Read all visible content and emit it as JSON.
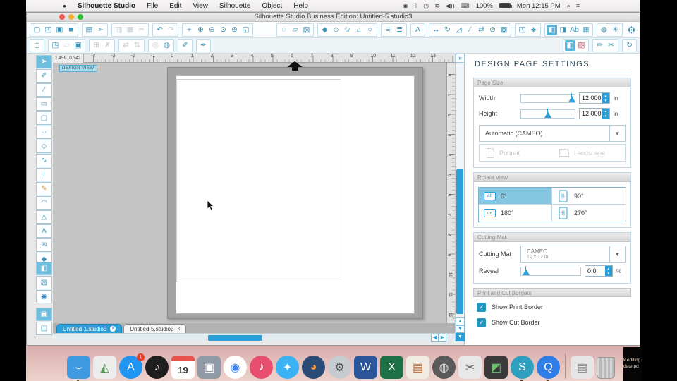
{
  "menu_bar": {
    "apple_glyph": "●",
    "items": [
      "Silhouette Studio",
      "File",
      "Edit",
      "View",
      "Silhouette",
      "Object",
      "Help"
    ],
    "status": {
      "icons_left": [
        {
          "name": "screen-record-icon",
          "glyph": "◉"
        },
        {
          "name": "bluetooth-icon",
          "glyph": "ᛒ"
        },
        {
          "name": "time-machine-icon",
          "glyph": "◷"
        },
        {
          "name": "wifi-icon",
          "glyph": "≋"
        },
        {
          "name": "volume-icon",
          "glyph": "◀))"
        },
        {
          "name": "input-source-icon",
          "glyph": "⌨"
        }
      ],
      "battery_percent": "100%",
      "clock": "Mon 12:15 PM",
      "icons_right": [
        {
          "name": "spotlight-icon",
          "glyph": "⌕"
        },
        {
          "name": "notification-center-icon",
          "glyph": "≡"
        }
      ]
    }
  },
  "window": {
    "title": "Silhouette Studio Business Edition: Untitled-5.studio3"
  },
  "toolbar_main": {
    "groups_left": [
      [
        {
          "name": "new-file-icon",
          "glyph": "▢"
        },
        {
          "name": "open-file-icon",
          "glyph": "◰"
        },
        {
          "name": "save-icon",
          "glyph": "▣"
        },
        {
          "name": "save-as-icon",
          "glyph": "■"
        }
      ],
      [
        {
          "name": "print-icon",
          "glyph": "▤"
        },
        {
          "name": "send-to-machine-icon",
          "glyph": "➢"
        }
      ],
      [
        {
          "name": "copy-icon",
          "glyph": "▥",
          "state": "disabled"
        },
        {
          "name": "paste-icon",
          "glyph": "▦",
          "state": "disabled"
        },
        {
          "name": "cut-icon",
          "glyph": "✂",
          "state": "disabled"
        }
      ],
      [
        {
          "name": "undo-icon",
          "glyph": "↶"
        },
        {
          "name": "redo-icon",
          "glyph": "↷",
          "state": "disabled"
        }
      ],
      [
        {
          "name": "pan-icon",
          "glyph": "⌖"
        },
        {
          "name": "zoom-in-icon",
          "glyph": "⊕"
        },
        {
          "name": "zoom-out-icon",
          "glyph": "⊖"
        },
        {
          "name": "zoom-selection-icon",
          "glyph": "⊙"
        },
        {
          "name": "drag-zoom-icon",
          "glyph": "⊛"
        },
        {
          "name": "fit-to-page-icon",
          "glyph": "◱"
        }
      ]
    ],
    "groups_right": [
      [
        {
          "name": "lasso-icon",
          "glyph": "◌"
        },
        {
          "name": "draw-selection-icon",
          "glyph": "▱"
        },
        {
          "name": "select-by-color-icon",
          "glyph": "▧"
        }
      ],
      [
        {
          "name": "fill-color-icon",
          "glyph": "◆"
        },
        {
          "name": "line-color-icon",
          "glyph": "◇"
        },
        {
          "name": "fill-pattern-icon",
          "glyph": "✩"
        },
        {
          "name": "fill-gradient-icon",
          "glyph": "⌂"
        },
        {
          "name": "shape-style-icon",
          "glyph": "○"
        }
      ],
      [
        {
          "name": "line-style-icon",
          "glyph": "≡"
        },
        {
          "name": "line-thickness-icon",
          "glyph": "≣"
        }
      ],
      [
        {
          "name": "text-style-icon",
          "glyph": "A"
        }
      ],
      [
        {
          "name": "move-icon",
          "glyph": "↔"
        },
        {
          "name": "rotate-icon",
          "glyph": "↻"
        },
        {
          "name": "scale-icon",
          "glyph": "◿"
        },
        {
          "name": "shear-icon",
          "glyph": "∕"
        },
        {
          "name": "mirror-icon",
          "glyph": "⇄"
        },
        {
          "name": "erase-icon",
          "glyph": "⊘"
        },
        {
          "name": "image-effects-icon",
          "glyph": "▩"
        }
      ],
      [
        {
          "name": "offset-icon",
          "glyph": "◳"
        },
        {
          "name": "symbol-icon",
          "glyph": "◈"
        }
      ],
      [
        {
          "name": "page-settings-icon",
          "glyph": "◧",
          "state": "active"
        },
        {
          "name": "registration-marks-icon",
          "glyph": "◨"
        },
        {
          "name": "text-options-icon",
          "glyph": "Ab"
        },
        {
          "name": "grid-options-icon",
          "glyph": "▦"
        }
      ],
      [
        {
          "name": "object-color-icon",
          "glyph": "◍"
        },
        {
          "name": "effects-icon",
          "glyph": "✳"
        }
      ]
    ],
    "gear": {
      "name": "preferences-gear-icon",
      "glyph": "⚙"
    }
  },
  "toolbar_quick": {
    "groups_left": [
      [
        {
          "name": "selection-tools-icon",
          "glyph": "◻"
        }
      ],
      [
        {
          "name": "zoom-to-selection-icon",
          "glyph": "◳"
        },
        {
          "name": "copy-merge-icon",
          "glyph": "▱",
          "state": "disabled"
        },
        {
          "name": "duplicate-icon",
          "glyph": "▣"
        }
      ],
      [
        {
          "name": "group-icon",
          "glyph": "⊞",
          "state": "disabled"
        },
        {
          "name": "delete-icon",
          "glyph": "✗",
          "state": "disabled"
        }
      ],
      [
        {
          "name": "replicate-icon",
          "glyph": "⇄",
          "state": "disabled"
        },
        {
          "name": "nest-icon",
          "glyph": "⇅",
          "state": "disabled"
        }
      ],
      [
        {
          "name": "weld-icon",
          "glyph": "◎",
          "state": "disabled"
        },
        {
          "name": "trace-icon",
          "glyph": "◍"
        }
      ],
      [
        {
          "name": "eraser-icon",
          "glyph": "✐"
        }
      ],
      [
        {
          "name": "knife-icon",
          "glyph": "✒"
        }
      ]
    ],
    "groups_right": [
      [
        {
          "name": "design-page-settings-icon",
          "glyph": "◧",
          "state": "active"
        },
        {
          "name": "pixscan-icon",
          "glyph": "▨",
          "fg": "#b05a6a"
        }
      ],
      [
        {
          "name": "sketch-pens-icon",
          "glyph": "✏"
        },
        {
          "name": "send-to-cutter-icon",
          "glyph": "✂"
        }
      ],
      [
        {
          "name": "sync-icon",
          "glyph": "↻"
        }
      ]
    ]
  },
  "tool_palette": {
    "groups": [
      [
        {
          "name": "select-tool-icon",
          "glyph": "➤",
          "state": "active"
        },
        {
          "name": "edit-points-tool-icon",
          "glyph": "✐"
        },
        {
          "name": "line-tool-icon",
          "glyph": "∕"
        },
        {
          "name": "rectangle-tool-icon",
          "glyph": "▭"
        },
        {
          "name": "rounded-rectangle-tool-icon",
          "glyph": "▢"
        },
        {
          "name": "ellipse-tool-icon",
          "glyph": "○"
        },
        {
          "name": "polygon-tool-icon",
          "glyph": "◇"
        },
        {
          "name": "curve-tool-icon",
          "glyph": "∿"
        },
        {
          "name": "freehand-tool-icon",
          "glyph": "≀"
        },
        {
          "name": "smooth-freehand-tool-icon",
          "glyph": "✎",
          "fg": "#d89a3c"
        },
        {
          "name": "arc-tool-icon",
          "glyph": "◠"
        },
        {
          "name": "regular-polygon-tool-icon",
          "glyph": "△"
        },
        {
          "name": "text-tool-icon",
          "glyph": "A"
        },
        {
          "name": "notes-tool-icon",
          "glyph": "✉"
        },
        {
          "name": "dropper-tool-icon",
          "glyph": "◆"
        }
      ],
      [
        {
          "name": "design-view-icon",
          "glyph": "◧",
          "state": "active"
        },
        {
          "name": "store-view-icon",
          "glyph": "▨"
        },
        {
          "name": "library-view-icon",
          "glyph": "◉",
          "fg": "#2d85c8"
        }
      ],
      [
        {
          "name": "fill-page-icon",
          "glyph": "▣",
          "state": "active"
        },
        {
          "name": "split-view-icon",
          "glyph": "◫"
        }
      ]
    ]
  },
  "canvas": {
    "view_label": "DESIGN VIEW",
    "coord_x": "1.459",
    "coord_y": "0.343",
    "ruler_h": [
      "-4",
      "-3",
      "-2",
      "-1",
      "0",
      "1",
      "2",
      "3",
      "4",
      "5",
      "6",
      "7",
      "8",
      "9",
      "10",
      "11",
      "12",
      "13"
    ],
    "ruler_v": [
      "0",
      "1",
      "2",
      "3",
      "4",
      "5",
      "6",
      "7",
      "8",
      "9",
      "10",
      "11",
      "12"
    ]
  },
  "tabs": {
    "items": [
      {
        "label": "Untitled-1.studio3",
        "active": false
      },
      {
        "label": "Untitled-5.studio3",
        "active": true
      }
    ]
  },
  "panel": {
    "title": "DESIGN PAGE SETTINGS",
    "page_size": {
      "header": "Page Size",
      "width_label": "Width",
      "width_value": "12.000",
      "width_unit": "in",
      "height_label": "Height",
      "height_value": "12.000",
      "height_unit": "in",
      "preset": "Automatic (CAMEO)",
      "portrait_label": "Portrait",
      "landscape_label": "Landscape"
    },
    "rotate_view": {
      "header": "Rotate View",
      "icon_text": "ab",
      "active_index": 0,
      "options": [
        "0°",
        "90°",
        "180°",
        "270°"
      ]
    },
    "cutting_mat": {
      "header": "Cutting Mat",
      "label": "Cutting Mat",
      "mat_name": "CAMEO",
      "mat_size": "12 x 12 in",
      "reveal_label": "Reveal",
      "reveal_value": "0.0",
      "reveal_unit": "%"
    },
    "borders": {
      "header": "Print and Cut Borders",
      "items": [
        "Show Print Border",
        "Show Cut Border"
      ]
    }
  },
  "ui": {
    "expand_button": "»",
    "scroll_up": "▲",
    "scroll_down": "▼",
    "scroll_left": "◀",
    "scroll_right": "▶",
    "dropdown": "▼",
    "check": "✓",
    "tab_close": "x",
    "spin_up": "▲",
    "spin_down": "▼"
  },
  "dock": {
    "items": [
      {
        "name": "finder-icon",
        "glyph": "⌣",
        "bg": "#3f9ae0",
        "running": true
      },
      {
        "name": "photos-icon",
        "glyph": "◭",
        "bg": "#ececec",
        "fg": "#5a9a5a"
      },
      {
        "name": "app-store-icon",
        "glyph": "A",
        "bg": "#2095f2",
        "shape": "round",
        "badge": "1"
      },
      {
        "name": "gauge-app-icon",
        "glyph": "♪",
        "bg": "#1f1f1f",
        "shape": "round",
        "fg": "#e8e8e8"
      },
      {
        "name": "calendar-icon",
        "kind": "calendar",
        "glyph": "19"
      },
      {
        "name": "displays-pref-icon",
        "glyph": "▣",
        "bg": "#8f9aa6"
      },
      {
        "name": "chrome-icon",
        "glyph": "◉",
        "bg": "#fff",
        "fg": "#4285f4",
        "shape": "round",
        "ring": "conic"
      },
      {
        "name": "itunes-icon",
        "glyph": "♪",
        "bg": "#e84f6e",
        "shape": "round"
      },
      {
        "name": "safari-icon",
        "glyph": "✦",
        "bg": "#3bb2f4",
        "shape": "round"
      },
      {
        "name": "firefox-icon",
        "glyph": "◕",
        "bg": "#2b4b77",
        "fg": "#ff9a2e",
        "shape": "round"
      },
      {
        "name": "system-preferences-icon",
        "glyph": "⚙",
        "bg": "#c7ccd1",
        "fg": "#555",
        "shape": "round"
      },
      {
        "name": "word-icon",
        "glyph": "W",
        "bg": "#2b579a"
      },
      {
        "name": "excel-icon",
        "glyph": "X",
        "bg": "#1e7145"
      },
      {
        "name": "office-app-icon",
        "glyph": "▤",
        "bg": "#f0ece4",
        "fg": "#c46a2e"
      },
      {
        "name": "installer-icon",
        "glyph": "◍",
        "bg": "#5a5a5a",
        "fg": "#ddd",
        "shape": "round"
      },
      {
        "name": "scissors-app-icon",
        "glyph": "✂",
        "bg": "#e8e8e8",
        "fg": "#555"
      },
      {
        "name": "photo-editor-icon",
        "glyph": "◩",
        "bg": "#3a3a3a",
        "fg": "#6ec06e"
      },
      {
        "name": "silhouette-studio-icon",
        "glyph": "S",
        "bg": "#2e9fbe",
        "shape": "round",
        "running": true
      },
      {
        "name": "quicktime-icon",
        "glyph": "Q",
        "bg": "#2f7de8",
        "shape": "round",
        "running": true
      },
      {
        "kind": "separator"
      },
      {
        "name": "documents-stack-icon",
        "glyph": "▤",
        "bg": "#e6e6e6",
        "fg": "#888"
      },
      {
        "name": "trash-icon",
        "kind": "trash"
      }
    ]
  },
  "desktop": {
    "file_label_lines": [
      "k editing",
      "date.pd"
    ]
  }
}
